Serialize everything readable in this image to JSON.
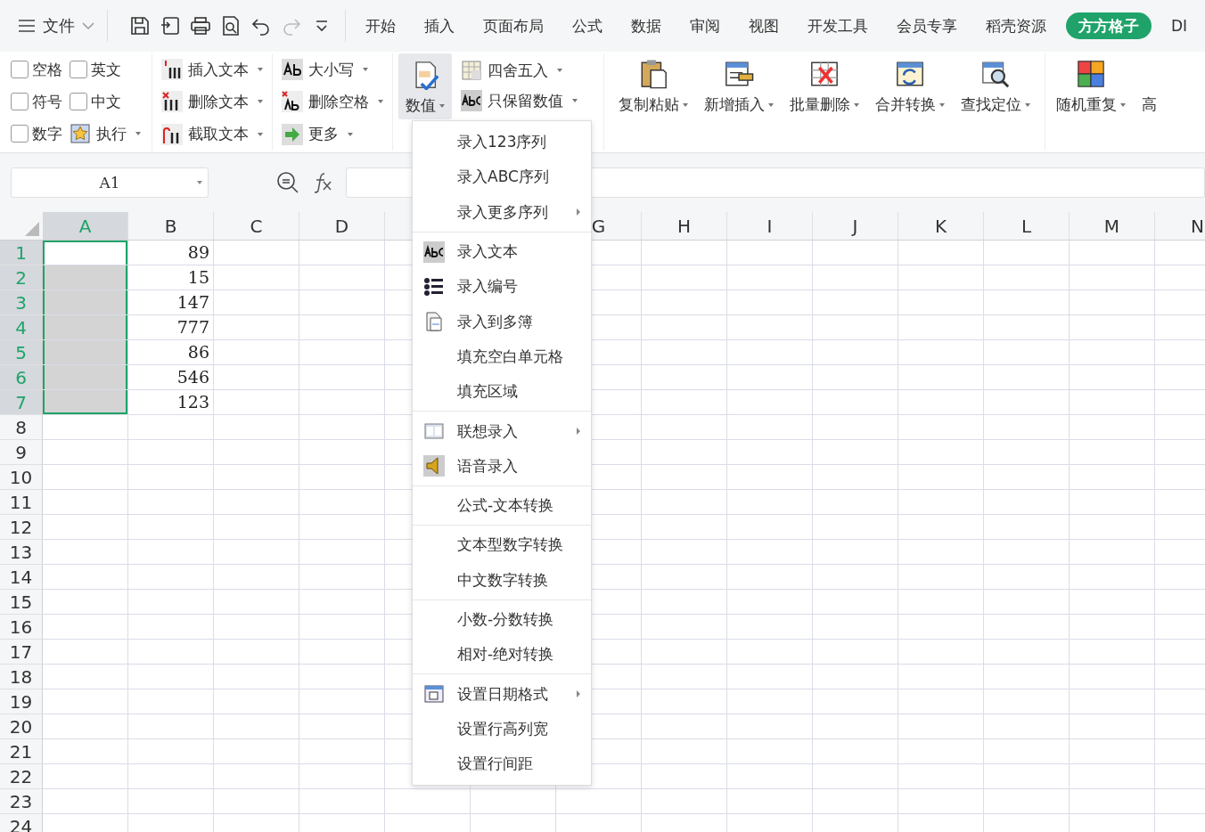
{
  "file_menu": {
    "label": "文件"
  },
  "tabs": [
    {
      "label": "开始",
      "selected": false
    },
    {
      "label": "插入",
      "selected": false
    },
    {
      "label": "页面布局",
      "selected": false
    },
    {
      "label": "公式",
      "selected": false
    },
    {
      "label": "数据",
      "selected": false
    },
    {
      "label": "审阅",
      "selected": false
    },
    {
      "label": "视图",
      "selected": false
    },
    {
      "label": "开发工具",
      "selected": false
    },
    {
      "label": "会员专享",
      "selected": false
    },
    {
      "label": "稻壳资源",
      "selected": false
    },
    {
      "label": "方方格子",
      "selected": true
    },
    {
      "label": "DI",
      "selected": false
    }
  ],
  "ribbon": {
    "checkboxes": [
      {
        "label": "空格",
        "checked": false
      },
      {
        "label": "英文",
        "checked": false
      },
      {
        "label": "符号",
        "checked": false
      },
      {
        "label": "中文",
        "checked": false
      },
      {
        "label": "数字",
        "checked": false
      }
    ],
    "execute": {
      "label": "执行"
    },
    "text_tools": [
      {
        "label": "插入文本"
      },
      {
        "label": "删除文本"
      },
      {
        "label": "截取文本"
      }
    ],
    "case_tools": [
      {
        "label": "大小写"
      },
      {
        "label": "删除空格"
      },
      {
        "label": "更多"
      }
    ],
    "value_button": {
      "label": "数值",
      "selected": true
    },
    "value_tools": [
      {
        "label": "四舍五入"
      },
      {
        "label": "只保留数值"
      }
    ],
    "big_buttons": [
      {
        "label": "复制粘贴"
      },
      {
        "label": "新增插入"
      },
      {
        "label": "批量删除"
      },
      {
        "label": "合并转换"
      },
      {
        "label": "查找定位"
      }
    ],
    "big_buttons_2": [
      {
        "label": "随机重复"
      }
    ],
    "cut_label": "高"
  },
  "name_box": {
    "value": "A1"
  },
  "sheet": {
    "columns_left": [
      {
        "label": "A",
        "selected": true
      },
      {
        "label": "B",
        "selected": false
      },
      {
        "label": "C",
        "selected": false
      },
      {
        "label": "D",
        "selected": false
      }
    ],
    "columns_right": [
      {
        "label": "G",
        "selected": false
      },
      {
        "label": "H",
        "selected": false
      },
      {
        "label": "I",
        "selected": false
      },
      {
        "label": "J",
        "selected": false
      },
      {
        "label": "K",
        "selected": false
      },
      {
        "label": "L",
        "selected": false
      },
      {
        "label": "M",
        "selected": false
      },
      {
        "label": "N",
        "selected": false
      }
    ],
    "rows": [
      {
        "header": "1",
        "selected": true,
        "cells": [
          "",
          "89"
        ]
      },
      {
        "header": "2",
        "selected": true,
        "cells": [
          "",
          "15"
        ]
      },
      {
        "header": "3",
        "selected": true,
        "cells": [
          "",
          "147"
        ]
      },
      {
        "header": "4",
        "selected": true,
        "cells": [
          "",
          "777"
        ]
      },
      {
        "header": "5",
        "selected": true,
        "cells": [
          "",
          "86"
        ]
      },
      {
        "header": "6",
        "selected": true,
        "cells": [
          "",
          "546"
        ]
      },
      {
        "header": "7",
        "selected": true,
        "cells": [
          "",
          "123"
        ]
      },
      {
        "header": "8",
        "selected": false,
        "cells": []
      },
      {
        "header": "9",
        "selected": false,
        "cells": []
      },
      {
        "header": "10",
        "selected": false,
        "cells": []
      },
      {
        "header": "11",
        "selected": false,
        "cells": []
      },
      {
        "header": "12",
        "selected": false,
        "cells": []
      },
      {
        "header": "13",
        "selected": false,
        "cells": []
      },
      {
        "header": "14",
        "selected": false,
        "cells": []
      },
      {
        "header": "15",
        "selected": false,
        "cells": []
      },
      {
        "header": "16",
        "selected": false,
        "cells": []
      },
      {
        "header": "17",
        "selected": false,
        "cells": []
      },
      {
        "header": "18",
        "selected": false,
        "cells": []
      },
      {
        "header": "19",
        "selected": false,
        "cells": []
      },
      {
        "header": "20",
        "selected": false,
        "cells": []
      },
      {
        "header": "21",
        "selected": false,
        "cells": []
      },
      {
        "header": "22",
        "selected": false,
        "cells": []
      },
      {
        "header": "23",
        "selected": false,
        "cells": []
      },
      {
        "header": "24",
        "selected": false,
        "cells": []
      }
    ]
  },
  "dropdown_menu": [
    [
      {
        "label": "录入123序列",
        "submenu": false
      },
      {
        "label": "录入ABC序列",
        "submenu": false
      },
      {
        "label": "录入更多序列",
        "submenu": true
      }
    ],
    [
      {
        "label": "录入文本",
        "submenu": false
      },
      {
        "label": "录入编号",
        "submenu": false
      },
      {
        "label": "录入到多簿",
        "submenu": false
      },
      {
        "label": "填充空白单元格",
        "submenu": false
      },
      {
        "label": "填充区域",
        "submenu": false
      }
    ],
    [
      {
        "label": "联想录入",
        "submenu": true
      },
      {
        "label": "语音录入",
        "submenu": false
      }
    ],
    [
      {
        "label": "公式-文本转换",
        "submenu": false
      }
    ],
    [
      {
        "label": "文本型数字转换",
        "submenu": false
      },
      {
        "label": "中文数字转换",
        "submenu": false
      }
    ],
    [
      {
        "label": "小数-分数转换",
        "submenu": false
      },
      {
        "label": "相对-绝对转换",
        "submenu": false
      }
    ],
    [
      {
        "label": "设置日期格式",
        "submenu": true
      },
      {
        "label": "设置行高列宽",
        "submenu": false
      },
      {
        "label": "设置行间距",
        "submenu": false
      }
    ]
  ]
}
